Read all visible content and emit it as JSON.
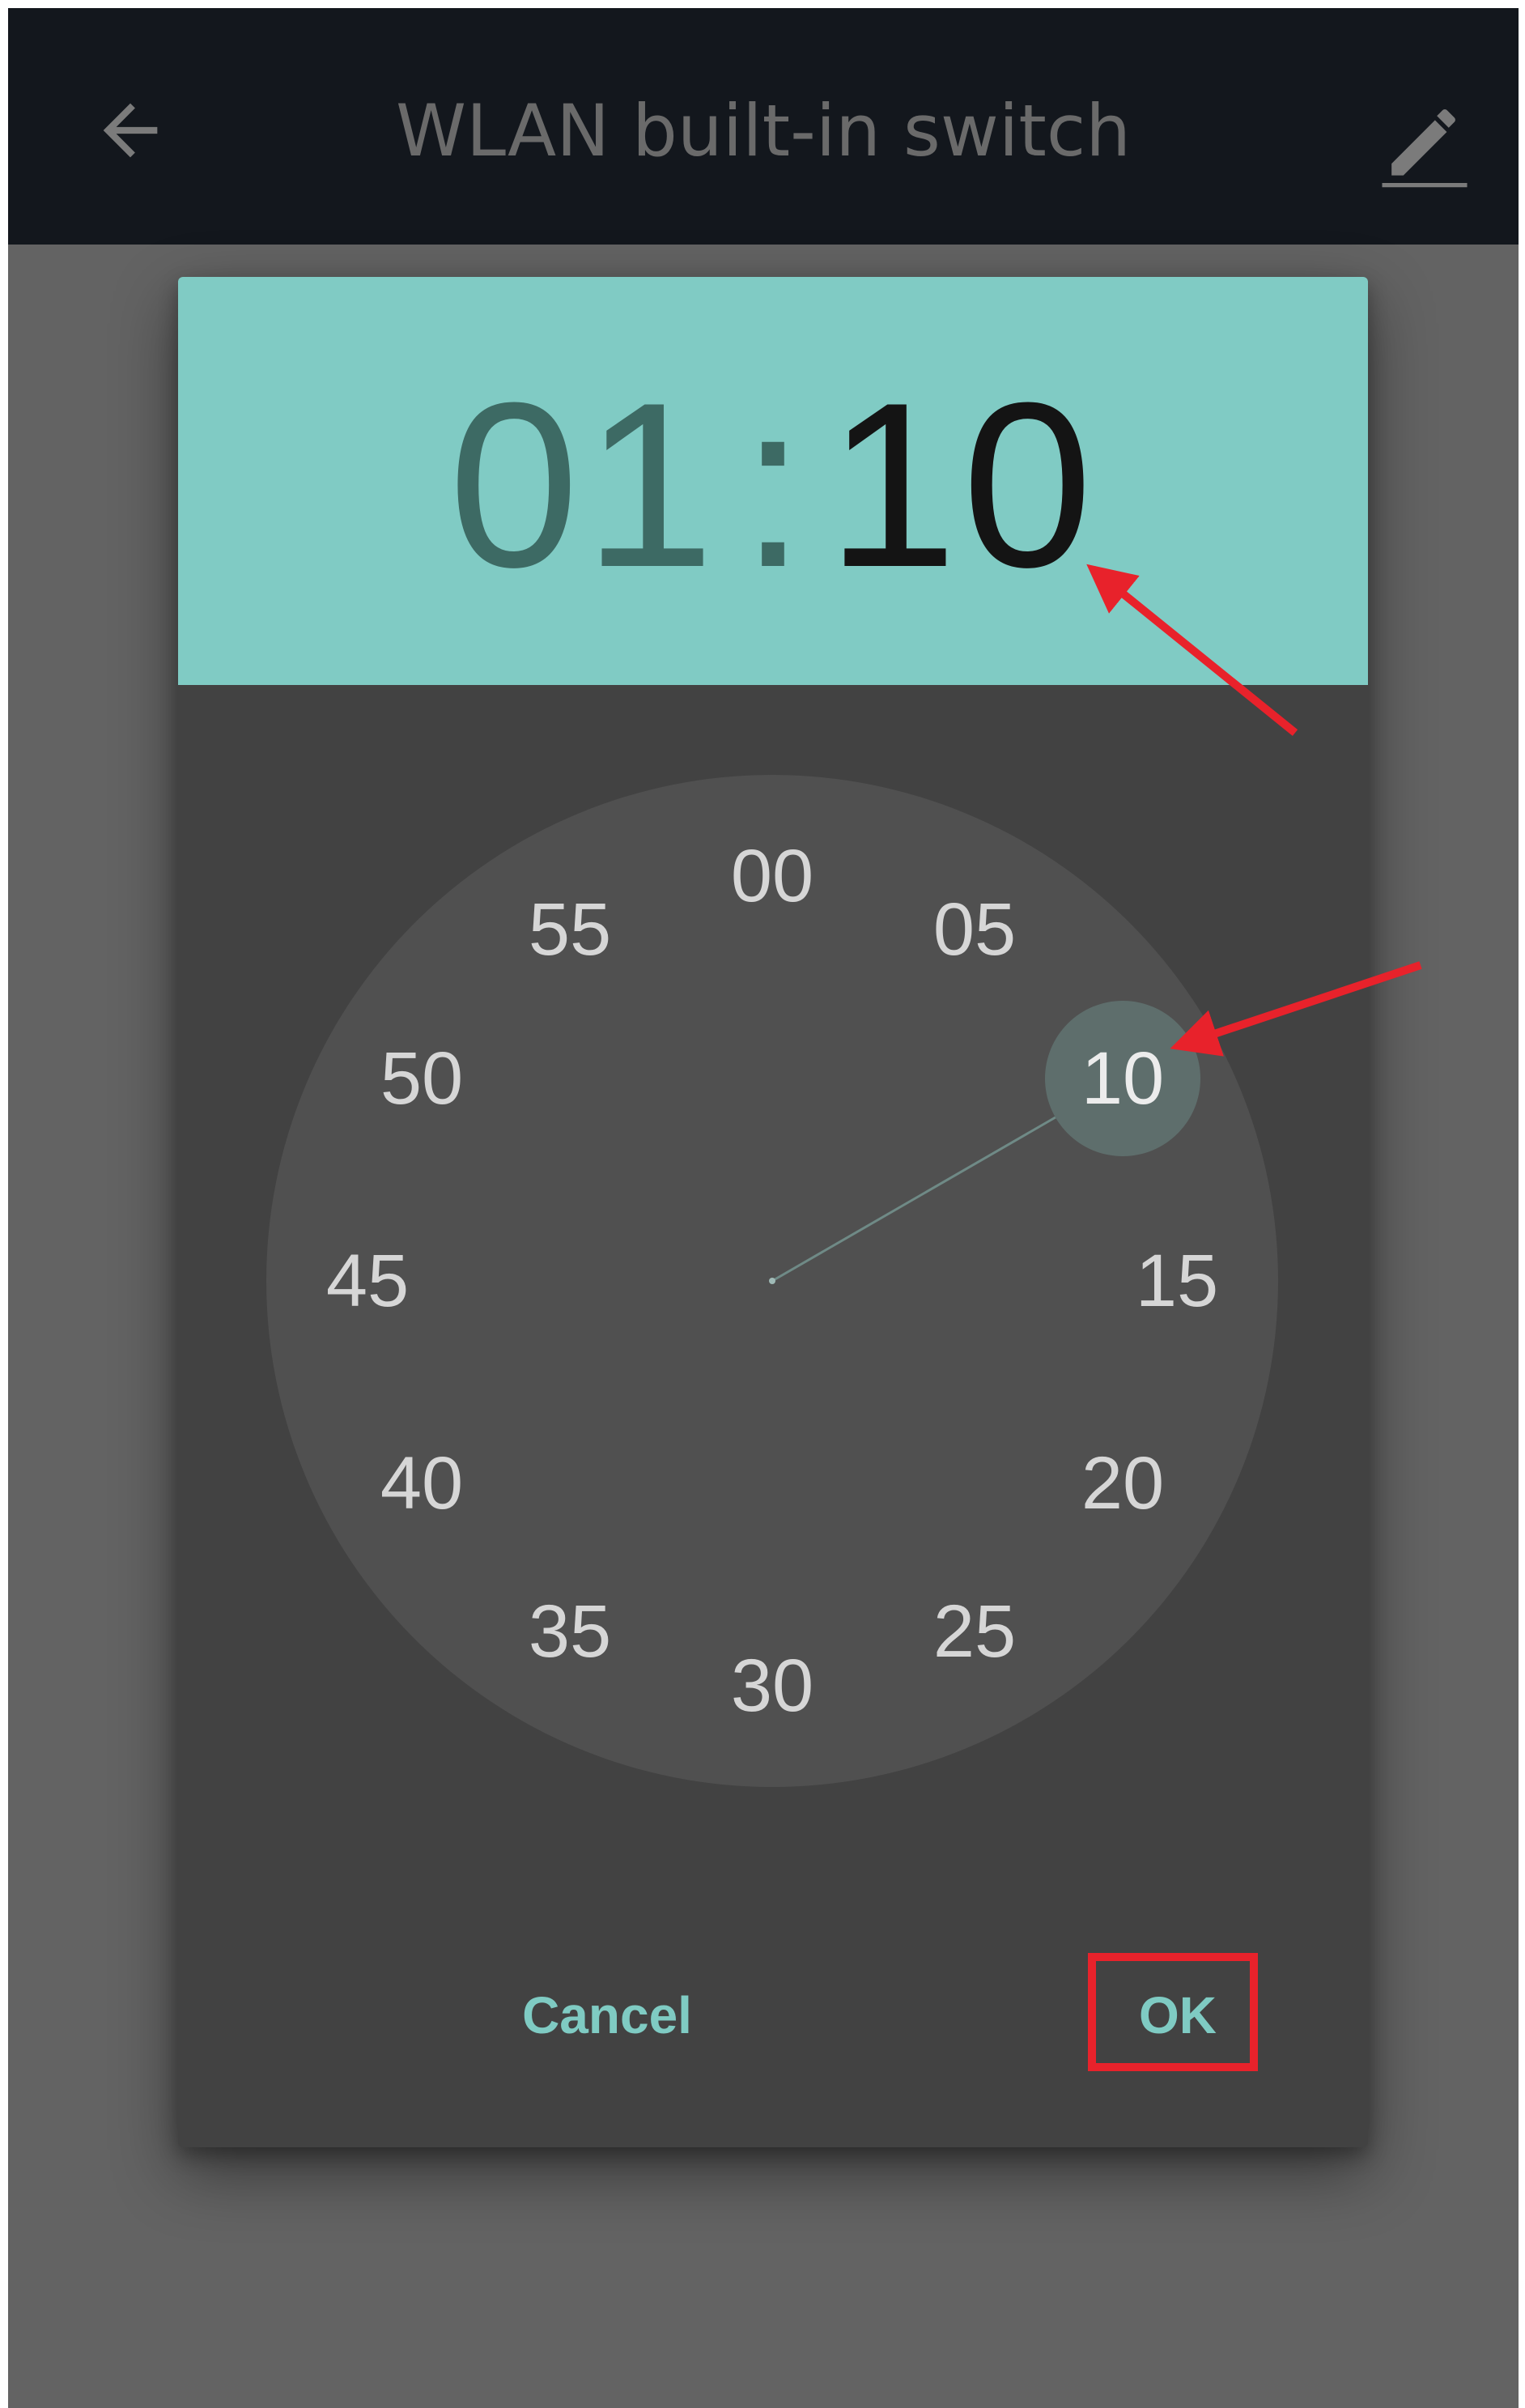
{
  "app_bar": {
    "title": "WLAN built-in switch",
    "back_icon": "arrow-left-icon",
    "edit_icon": "pencil-icon"
  },
  "time_picker": {
    "hours": "01",
    "separator": ":",
    "minutes": "10",
    "selected_minute": "10",
    "clock_numbers": [
      "00",
      "05",
      "10",
      "15",
      "20",
      "25",
      "30",
      "35",
      "40",
      "45",
      "50",
      "55"
    ],
    "cancel_label": "Cancel",
    "ok_label": "OK"
  },
  "colors": {
    "header_background": "#80cbc4",
    "accent_text": "#7fcbc3",
    "annotation": "#e8222b"
  }
}
